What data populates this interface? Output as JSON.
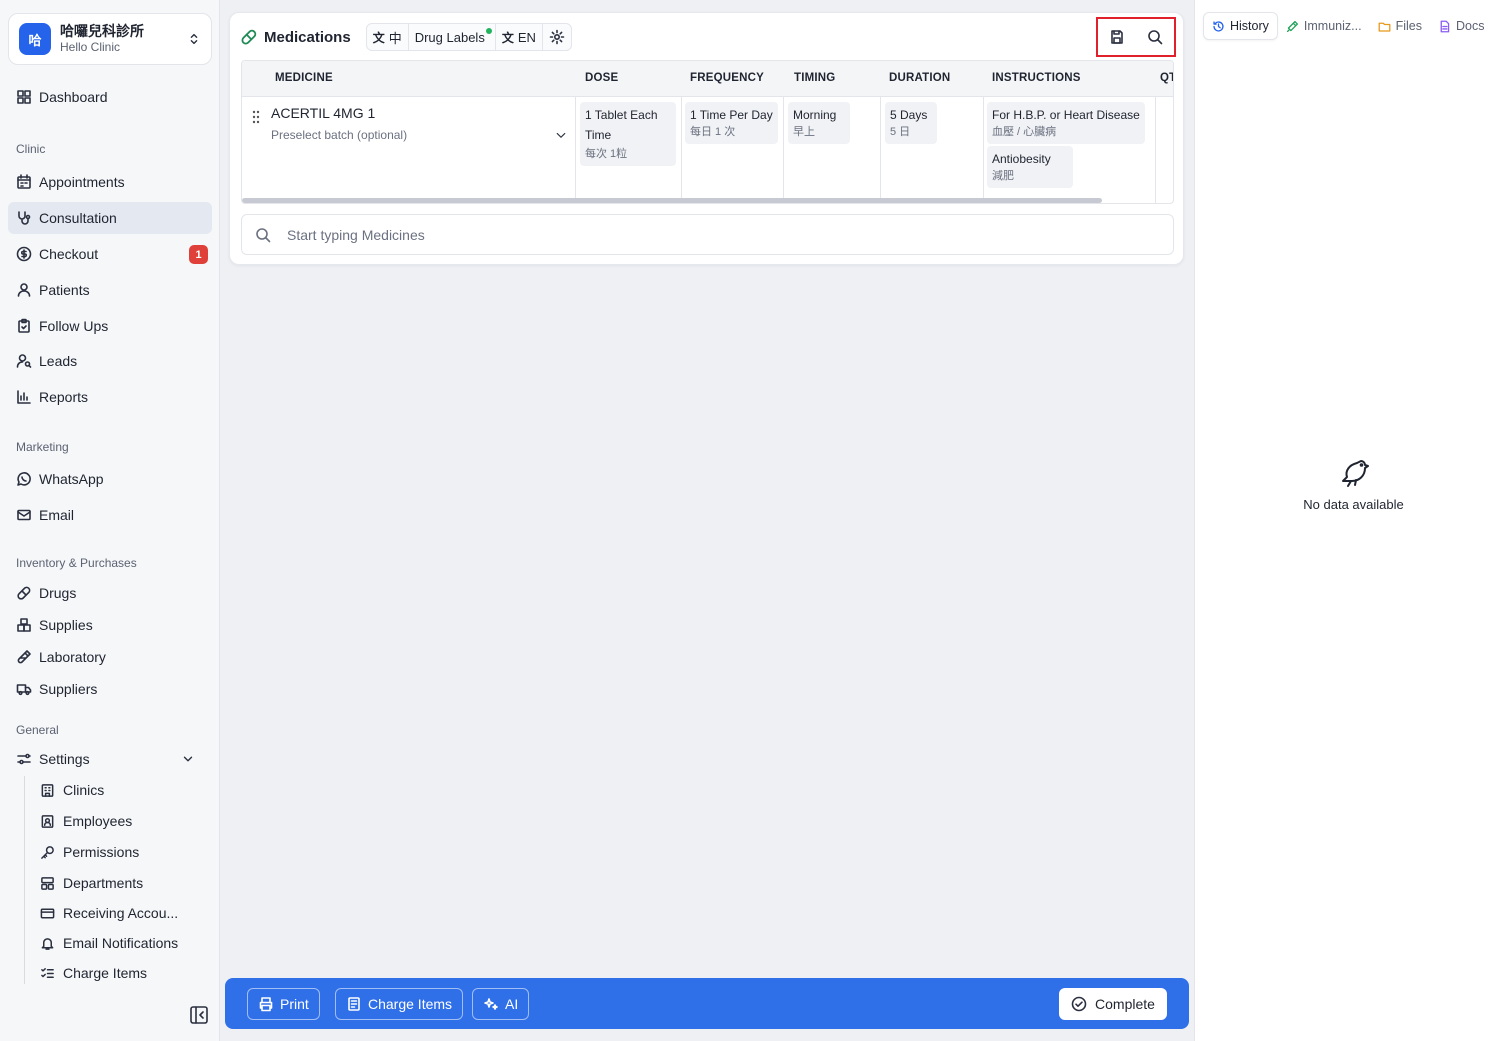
{
  "sidebar": {
    "clinic": {
      "logo": "哈",
      "name": "哈囉兒科診所",
      "sub": "Hello Clinic"
    },
    "dashboard": "Dashboard",
    "sections": {
      "clinic": "Clinic",
      "marketing": "Marketing",
      "inventory": "Inventory & Purchases",
      "general": "General"
    },
    "items": {
      "appointments": "Appointments",
      "consultation": "Consultation",
      "checkout": "Checkout",
      "checkout_badge": "1",
      "patients": "Patients",
      "followups": "Follow Ups",
      "leads": "Leads",
      "reports": "Reports",
      "whatsapp": "WhatsApp",
      "email": "Email",
      "drugs": "Drugs",
      "supplies": "Supplies",
      "laboratory": "Laboratory",
      "suppliers": "Suppliers",
      "settings": "Settings"
    },
    "settings_sub": {
      "clinics": "Clinics",
      "employees": "Employees",
      "permissions": "Permissions",
      "departments": "Departments",
      "receiving": "Receiving Accou...",
      "email_notifications": "Email Notifications",
      "charge_items": "Charge Items"
    }
  },
  "medications": {
    "title": "Medications",
    "lang_zh": "中",
    "drug_labels": "Drug Labels",
    "lang_en": "EN",
    "columns": {
      "medicine": "MEDICINE",
      "dose": "DOSE",
      "frequency": "FREQUENCY",
      "timing": "TIMING",
      "duration": "DURATION",
      "instructions": "INSTRUCTIONS",
      "qty": "QT"
    },
    "row": {
      "name": "ACERTIL 4MG 1",
      "batch_placeholder": "Preselect batch (optional)",
      "dose_en_1": "1 Tablet Each",
      "dose_en_2": "Time",
      "dose_zh": "每次 1粒",
      "freq_en": "1 Time Per Day",
      "freq_zh": "每日 1 次",
      "timing_en": "Morning",
      "timing_zh": "早上",
      "duration_en": "5 Days",
      "duration_zh": "5 日",
      "instr1_en": "For H.B.P. or Heart Disease",
      "instr1_zh": "血壓 / 心臟病",
      "instr2_en": "Antiobesity",
      "instr2_zh": "減肥"
    },
    "search_placeholder": "Start typing Medicines"
  },
  "bottom_bar": {
    "print": "Print",
    "charge_items": "Charge Items",
    "ai": "AI",
    "complete": "Complete"
  },
  "right_panel": {
    "tabs": [
      "History",
      "Immuniz...",
      "Files",
      "Docs"
    ],
    "empty": "No data available"
  },
  "colors": {
    "accent": "#2f6fe8",
    "badge": "#e0403a",
    "highlight_box": "#e0202a",
    "status_dot": "#22b35e"
  }
}
